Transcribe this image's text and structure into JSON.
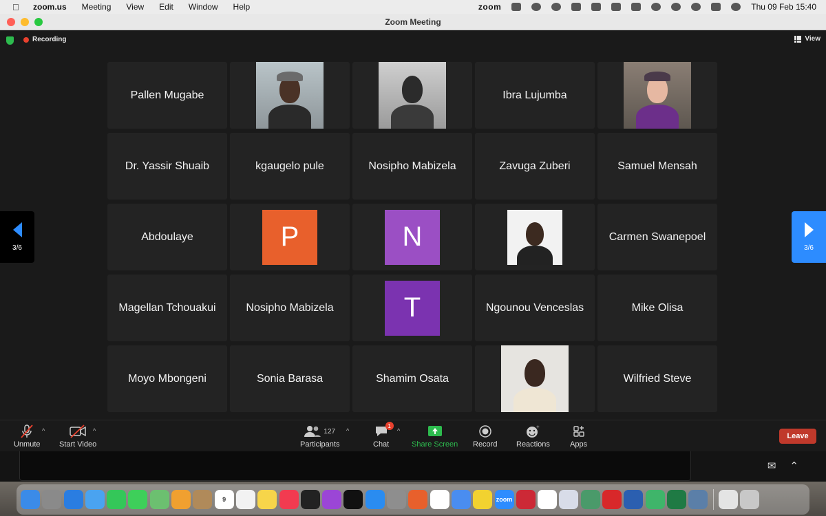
{
  "menubar": {
    "app_name": "zoom.us",
    "menus": [
      "Meeting",
      "View",
      "Edit",
      "Window",
      "Help"
    ],
    "tray_zoom": "zoom",
    "datetime": "Thu 09 Feb  15:40"
  },
  "window": {
    "title": "Zoom Meeting"
  },
  "meeting": {
    "recording_label": "Recording",
    "view_label": "View",
    "page_left": "3/6",
    "page_right": "3/6"
  },
  "participants": [
    {
      "name": "Pallen Mugabe",
      "kind": "name"
    },
    {
      "name": "",
      "kind": "photo",
      "photo": "man-cap"
    },
    {
      "name": "",
      "kind": "photo",
      "photo": "woman-bw"
    },
    {
      "name": "Ibra Lujumba",
      "kind": "name"
    },
    {
      "name": "",
      "kind": "photo",
      "photo": "woman-glasses"
    },
    {
      "name": "Dr. Yassir Shuaib",
      "kind": "name"
    },
    {
      "name": "kgaugelo pule",
      "kind": "name"
    },
    {
      "name": "Nosipho Mabizela",
      "kind": "name"
    },
    {
      "name": "Zavuga Zuberi",
      "kind": "name"
    },
    {
      "name": "Samuel Mensah",
      "kind": "name"
    },
    {
      "name": "Abdoulaye",
      "kind": "name"
    },
    {
      "name": "P",
      "kind": "letter",
      "color": "#e8602c"
    },
    {
      "name": "N",
      "kind": "letter",
      "color": "#9b4fc4"
    },
    {
      "name": "",
      "kind": "photo",
      "photo": "man-white-bg"
    },
    {
      "name": "Carmen Swanepoel",
      "kind": "name"
    },
    {
      "name": "Magellan Tchouakui",
      "kind": "name"
    },
    {
      "name": "Nosipho Mabizela",
      "kind": "name"
    },
    {
      "name": "T",
      "kind": "letter",
      "color": "#7b33b0"
    },
    {
      "name": "Ngounou Venceslas",
      "kind": "name"
    },
    {
      "name": "Mike Olisa",
      "kind": "name"
    },
    {
      "name": "Moyo Mbongeni",
      "kind": "name"
    },
    {
      "name": "Sonia Barasa",
      "kind": "name"
    },
    {
      "name": "Shamim Osata",
      "kind": "name"
    },
    {
      "name": "",
      "kind": "photo",
      "photo": "man-shirt"
    },
    {
      "name": "Wilfried Steve",
      "kind": "name"
    }
  ],
  "toolbar": {
    "unmute": "Unmute",
    "start_video": "Start Video",
    "participants": "Participants",
    "participant_count": "127",
    "chat": "Chat",
    "chat_badge": "1",
    "share_screen": "Share Screen",
    "record": "Record",
    "reactions": "Reactions",
    "apps": "Apps",
    "leave": "Leave"
  },
  "colors": {
    "accent": "#2d8cff",
    "share_green": "#2dbb4e",
    "leave_red": "#c0392b",
    "recording_red": "#e8412e"
  },
  "dock": {
    "apps": [
      {
        "name": "finder-icon",
        "color": "#3b8be8",
        "label": ""
      },
      {
        "name": "launchpad-icon",
        "color": "#8a8a8a",
        "label": ""
      },
      {
        "name": "safari-icon",
        "color": "#2a7de1",
        "label": ""
      },
      {
        "name": "mail-icon",
        "color": "#4aa3f0",
        "label": ""
      },
      {
        "name": "facetime-icon",
        "color": "#34c759",
        "label": ""
      },
      {
        "name": "messages-icon",
        "color": "#3ecf5a",
        "label": ""
      },
      {
        "name": "maps-icon",
        "color": "#6cc070",
        "label": ""
      },
      {
        "name": "photos-icon",
        "color": "#f0a030",
        "label": ""
      },
      {
        "name": "contacts-icon",
        "color": "#b08a5a",
        "label": ""
      },
      {
        "name": "calendar-icon",
        "color": "#ffffff",
        "label": "9"
      },
      {
        "name": "reminders-icon",
        "color": "#f2f2f2",
        "label": ""
      },
      {
        "name": "notes-icon",
        "color": "#f7d54a",
        "label": ""
      },
      {
        "name": "music-icon",
        "color": "#f23b50",
        "label": ""
      },
      {
        "name": "terminal-icon",
        "color": "#222222",
        "label": ""
      },
      {
        "name": "podcasts-icon",
        "color": "#9b46d6",
        "label": ""
      },
      {
        "name": "tv-icon",
        "color": "#111111",
        "label": ""
      },
      {
        "name": "app-store-icon",
        "color": "#2a8cf0",
        "label": ""
      },
      {
        "name": "system-preferences-icon",
        "color": "#8e8e8e",
        "label": ""
      },
      {
        "name": "firefox-icon",
        "color": "#e8602c",
        "label": ""
      },
      {
        "name": "ipa-icon",
        "color": "#ffffff",
        "label": ""
      },
      {
        "name": "chrome-icon",
        "color": "#4a8df0",
        "label": ""
      },
      {
        "name": "activity-icon",
        "color": "#f2d230",
        "label": ""
      },
      {
        "name": "zoom-icon",
        "color": "#2d8cff",
        "label": "zoom"
      },
      {
        "name": "zotero-icon",
        "color": "#cc2936",
        "label": ""
      },
      {
        "name": "slack-icon",
        "color": "#ffffff",
        "label": ""
      },
      {
        "name": "r-icon",
        "color": "#d8dce8",
        "label": ""
      },
      {
        "name": "vpn-icon",
        "color": "#4a9a6a",
        "label": ""
      },
      {
        "name": "acrobat-icon",
        "color": "#d8282a",
        "label": ""
      },
      {
        "name": "word-icon",
        "color": "#2b5fb0",
        "label": ""
      },
      {
        "name": "atom-icon",
        "color": "#3fb56a",
        "label": ""
      },
      {
        "name": "excel-icon",
        "color": "#1f7a44",
        "label": ""
      },
      {
        "name": "screens-icon",
        "color": "#5b7fa8",
        "label": ""
      },
      {
        "name": "document-icon",
        "color": "#e4e4e4",
        "label": ""
      },
      {
        "name": "trash-icon",
        "color": "#c8c8c8",
        "label": ""
      }
    ]
  }
}
